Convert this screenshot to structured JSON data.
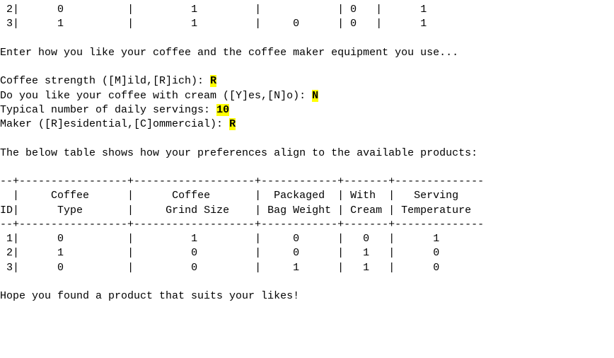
{
  "partial_row": {
    "id": "2",
    "coffee_type": "0",
    "grind_size": "1",
    "bag_weight": "",
    "cream": "0",
    "temp": "1"
  },
  "partial_row2": {
    "id": "3",
    "coffee_type": "1",
    "grind_size": "1",
    "bag_weight": "0",
    "cream": "0",
    "temp": "1"
  },
  "intro": "Enter how you like your coffee and the coffee maker equipment you use...",
  "prompts": {
    "strength_label": "Coffee strength ([M]ild,[R]ich): ",
    "strength_value": "R",
    "cream_label": "Do you like your coffee with cream ([Y]es,[N]o): ",
    "cream_value": "N",
    "servings_label": "Typical number of daily servings: ",
    "servings_value": "10",
    "maker_label": "Maker ([R]esidential,[C]ommercial): ",
    "maker_value": "R"
  },
  "table_intro": "The below table shows how your preferences align to the available products:",
  "header": {
    "col_id": "ID",
    "col_type_l1": "Coffee",
    "col_type_l2": "Type",
    "col_grind_l1": "Coffee",
    "col_grind_l2": "Grind Size",
    "col_weight_l1": "Packaged",
    "col_weight_l2": "Bag Weight",
    "col_cream_l1": "With",
    "col_cream_l2": "Cream",
    "col_temp_l1": "Serving",
    "col_temp_l2": "Temperature"
  },
  "rows": [
    {
      "id": "1",
      "coffee_type": "0",
      "grind_size": "1",
      "bag_weight": "0",
      "cream": "0",
      "temp": "1"
    },
    {
      "id": "2",
      "coffee_type": "1",
      "grind_size": "0",
      "bag_weight": "0",
      "cream": "1",
      "temp": "0"
    },
    {
      "id": "3",
      "coffee_type": "0",
      "grind_size": "0",
      "bag_weight": "1",
      "cream": "1",
      "temp": "0"
    }
  ],
  "closing": "Hope you found a product that suits your likes!",
  "chart_data": {
    "type": "table",
    "columns": [
      "ID",
      "Coffee Type",
      "Coffee Grind Size",
      "Packaged Bag Weight",
      "With Cream",
      "Serving Temperature"
    ],
    "rows": [
      [
        1,
        0,
        1,
        0,
        0,
        1
      ],
      [
        2,
        1,
        0,
        0,
        1,
        0
      ],
      [
        3,
        0,
        0,
        1,
        1,
        0
      ]
    ]
  }
}
